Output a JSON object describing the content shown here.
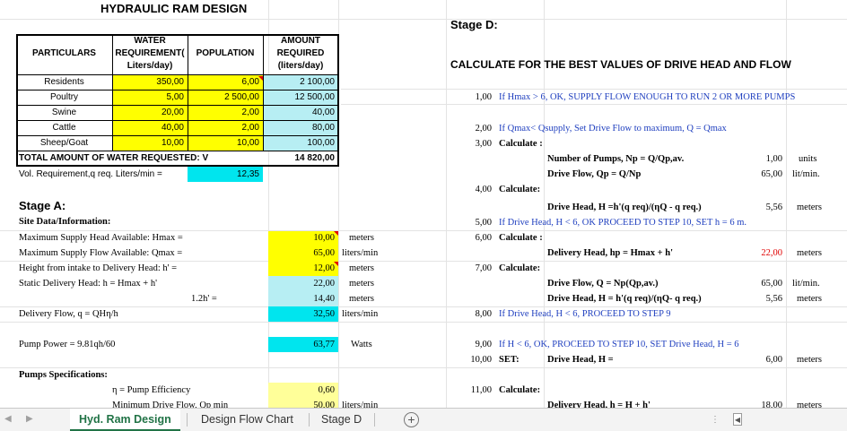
{
  "sheet": {
    "title": "HYDRAULIC RAM DESIGN",
    "table": {
      "headers": {
        "particulars": "PARTICULARS",
        "water_req_l1": "WATER",
        "water_req_l2": "REQUIREMENT(",
        "water_req_l3": "Liters/day)",
        "population": "POPULATION",
        "amount_l1": "AMOUNT",
        "amount_l2": "REQUIRED",
        "amount_l3": "(liters/day)"
      },
      "rows": [
        {
          "name": "Residents",
          "req": "350,00",
          "pop": "6,00",
          "amt": "2 100,00"
        },
        {
          "name": "Poultry",
          "req": "5,00",
          "pop": "2 500,00",
          "amt": "12 500,00"
        },
        {
          "name": "Swine",
          "req": "20,00",
          "pop": "2,00",
          "amt": "40,00"
        },
        {
          "name": "Cattle",
          "req": "40,00",
          "pop": "2,00",
          "amt": "80,00"
        },
        {
          "name": "Sheep/Goat",
          "req": "10,00",
          "pop": "10,00",
          "amt": "100,00"
        }
      ],
      "total_label": "TOTAL AMOUNT OF WATER REQUESTED: V",
      "total_value": "14 820,00",
      "vol_label": "Vol. Requirement,q req. Liters/min =",
      "vol_value": "12,35"
    },
    "stage_a": {
      "title": "Stage A:",
      "site_data": "Site Data/Information:",
      "rows": [
        {
          "label": "Maximum Supply  Head Available: Hmax  =",
          "value": "10,00",
          "unit": "meters"
        },
        {
          "label": "Maximum Supply Flow Available: Qmax    =",
          "value": "65,00",
          "unit": "liters/min"
        },
        {
          "label": "Height from intake to Delivery Head: h' =",
          "value": "12,00",
          "unit": "meters"
        },
        {
          "label": "Static Delivery Head: h = Hmax + h'",
          "value": "22,00",
          "unit": "meters"
        }
      ],
      "row_12h": {
        "label": "1.2h'  =",
        "value": "14,40",
        "unit": "meters"
      },
      "delivery_flow": {
        "label": "Delivery Flow, q  = QHη/h",
        "value": "32,50",
        "unit": "liters/min"
      },
      "pump_power": {
        "label": "Pump Power = 9.81qh/60",
        "value": "63,77",
        "unit": "Watts"
      },
      "pumps_spec": "Pumps Specifications:",
      "efficiency": {
        "label": "η = Pump Efficiency",
        "value": "0,60"
      },
      "min_drive": {
        "label": "Minimum Drive Flow, Qp min",
        "value": "50,00",
        "unit": "liters/min"
      }
    },
    "stage_d": {
      "title": "Stage D:",
      "heading": "CALCULATE FOR THE BEST VALUES OF DRIVE HEAD AND FLOW",
      "s1": {
        "num": "1,00",
        "text": "If Hmax > 6, OK, SUPPLY FLOW ENOUGH TO RUN 2 OR MORE PUMPS"
      },
      "s2": {
        "num": "2,00",
        "text": "If Qmax< Qsupply, Set Drive Flow to maximum, Q = Qmax"
      },
      "s3": {
        "num": "3,00",
        "text": "Calculate :"
      },
      "np": {
        "label": "Number of Pumps, Np = Q/Qp,av.",
        "value": "1,00",
        "unit": "units"
      },
      "qp": {
        "label": "Drive Flow, Qp = Q/Np",
        "value": "65,00",
        "unit": "lit/min."
      },
      "s4": {
        "num": "4,00",
        "text": "Calculate:"
      },
      "dh1": {
        "label": "Drive Head, H =h'(q req)/(ηQ - q req.)",
        "value": "5,56",
        "unit": "meters"
      },
      "s5": {
        "num": "5,00",
        "text": "If Drive Head, H < 6, OK PROCEED TO STEP 10, SET h = 6 m."
      },
      "s6": {
        "num": "6,00",
        "text": "Calculate :"
      },
      "hp": {
        "label": "Delivery Head, hp = Hmax + h'",
        "value": "22,00",
        "unit": "meters"
      },
      "s7": {
        "num": "7,00",
        "text": "Calculate:"
      },
      "dq": {
        "label": "Drive Flow, Q = Np(Qp,av.)",
        "value": "65,00",
        "unit": "lit/min."
      },
      "dh2": {
        "label": "Drive Head, H = h'(q req)/(ηQ- q req.)",
        "value": "5,56",
        "unit": "meters"
      },
      "s8": {
        "num": "8,00",
        "text": "If Drive Head, H < 6, PROCEED TO STEP 9"
      },
      "s9": {
        "num": "9,00",
        "text": "If H < 6, OK, PROCEED TO STEP 10, SET Drive Head, H = 6"
      },
      "s10": {
        "num": "10,00",
        "text": "SET:",
        "label": "Drive Head, H =",
        "value": "6,00",
        "unit": "meters"
      },
      "s11": {
        "num": "11,00",
        "text": "Calculate:"
      },
      "dlast": {
        "label": "Delivery Head, h = H + h'",
        "value": "18,00",
        "unit": "meters"
      }
    }
  },
  "tabs": [
    "Hyd. Ram Design",
    "Design Flow Chart",
    "Stage D"
  ],
  "active_tab": "Hyd. Ram Design",
  "icons": {
    "add_sheet": "+",
    "nav_left": "◀",
    "nav_right": "▶",
    "scroll_left": "◀"
  },
  "colors": {
    "yellow": "#ffff00",
    "cyan": "#00e5ee",
    "light_blue": "#b7eef3",
    "light_yellow": "#ffff99",
    "blue_text": "#1f3fbf",
    "red_text": "#e00000",
    "excel_green": "#217346"
  }
}
